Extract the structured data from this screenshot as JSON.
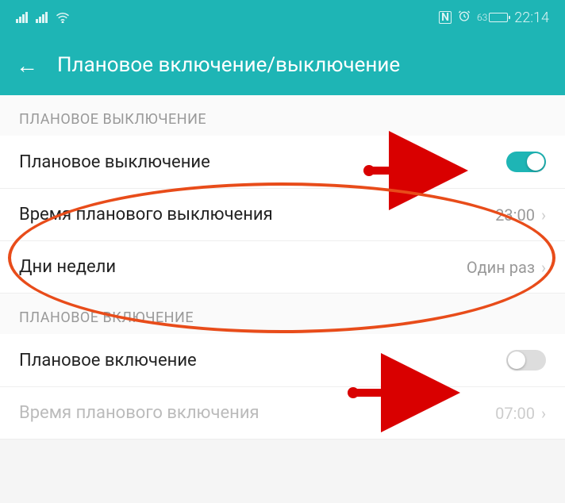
{
  "status_bar": {
    "nfc": "N",
    "battery_percent": "63",
    "time": "22:14"
  },
  "header": {
    "title": "Плановое включение/выключение"
  },
  "section_off": {
    "header": "ПЛАНОВОЕ ВЫКЛЮЧЕНИЕ",
    "toggle_row_label": "Плановое выключение",
    "toggle_state": "on",
    "time_row_label": "Время планового выключения",
    "time_value": "23:00",
    "days_row_label": "Дни недели",
    "days_value": "Один раз"
  },
  "section_on": {
    "header": "ПЛАНОВОЕ ВКЛЮЧЕНИЕ",
    "toggle_row_label": "Плановое включение",
    "toggle_state": "off",
    "time_row_label": "Время планового включения",
    "time_value": "07:00"
  }
}
